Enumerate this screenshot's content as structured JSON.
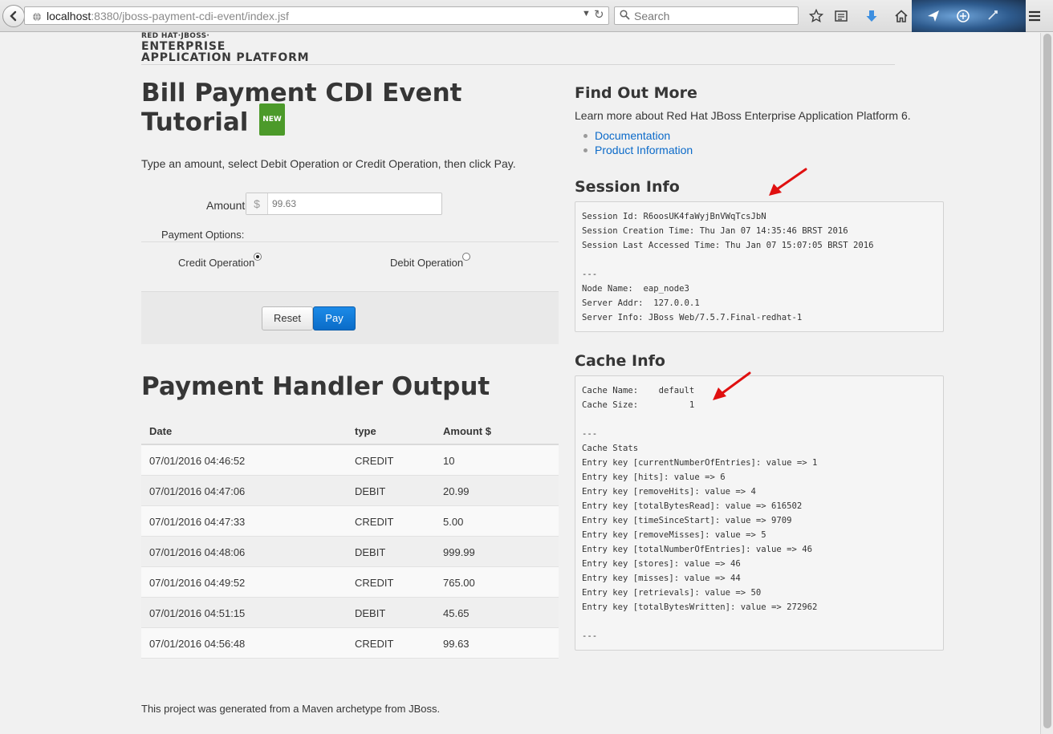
{
  "browser": {
    "url_host": "localhost",
    "url_rest": ":8380/jboss-payment-cdi-event/index.jsf",
    "search_placeholder": "Search"
  },
  "logo": {
    "line1": "RED HAT·JBOSS·",
    "line2": "ENTERPRISE",
    "line3": "APPLICATION PLATFORM"
  },
  "form": {
    "title_line1": "Bill Payment CDI Event",
    "title_line2": "Tutorial",
    "badge": "NEW",
    "instructions": "Type an amount, select Debit Operation or Credit Operation, then click Pay.",
    "amount_label": "Amount:",
    "currency_symbol": "$",
    "amount_value": "99.63",
    "payment_options_label": "Payment Options:",
    "credit_label": "Credit Operation",
    "debit_label": "Debit Operation",
    "selected_option": "credit",
    "reset_label": "Reset",
    "pay_label": "Pay"
  },
  "output": {
    "title": "Payment Handler Output",
    "headers": [
      "Date",
      "type",
      "Amount $"
    ],
    "rows": [
      [
        "07/01/2016 04:46:52",
        "CREDIT",
        "10"
      ],
      [
        "07/01/2016 04:47:06",
        "DEBIT",
        "20.99"
      ],
      [
        "07/01/2016 04:47:33",
        "CREDIT",
        "5.00"
      ],
      [
        "07/01/2016 04:48:06",
        "DEBIT",
        "999.99"
      ],
      [
        "07/01/2016 04:49:52",
        "CREDIT",
        "765.00"
      ],
      [
        "07/01/2016 04:51:15",
        "DEBIT",
        "45.65"
      ],
      [
        "07/01/2016 04:56:48",
        "CREDIT",
        "99.63"
      ]
    ]
  },
  "find_out_more": {
    "title": "Find Out More",
    "text": "Learn more about Red Hat JBoss Enterprise Application Platform 6.",
    "links": [
      "Documentation",
      "Product Information"
    ]
  },
  "session_info": {
    "title": "Session Info",
    "lines": [
      "Session Id: R6oosUK4faWyjBnVWqTcsJbN",
      "Session Creation Time: Thu Jan 07 14:35:46 BRST 2016",
      "Session Last Accessed Time: Thu Jan 07 15:07:05 BRST 2016",
      "",
      "---",
      "Node Name:  eap_node3",
      "Server Addr:  127.0.0.1",
      "Server Info: JBoss Web/7.5.7.Final-redhat-1"
    ]
  },
  "cache_info": {
    "title": "Cache Info",
    "lines": [
      "Cache Name:    default",
      "Cache Size:          1",
      "",
      "---",
      "Cache Stats",
      "Entry key [currentNumberOfEntries]: value => 1",
      "Entry key [hits]: value => 6",
      "Entry key [removeHits]: value => 4",
      "Entry key [totalBytesRead]: value => 616502",
      "Entry key [timeSinceStart]: value => 9709",
      "Entry key [removeMisses]: value => 5",
      "Entry key [totalNumberOfEntries]: value => 46",
      "Entry key [stores]: value => 46",
      "Entry key [misses]: value => 44",
      "Entry key [retrievals]: value => 50",
      "Entry key [totalBytesWritten]: value => 272962",
      "",
      "---"
    ]
  },
  "footer": {
    "text": "This project was generated from a Maven archetype from JBoss."
  },
  "colors": {
    "link": "#0b6ac9",
    "pay_button": "#0a6cc8",
    "new_badge": "#4c9a2a",
    "annotation_arrow": "#e01010"
  },
  "icons": {
    "toolbar": [
      "bookmark-star-icon",
      "reading-list-icon",
      "download-icon",
      "home-icon",
      "share-icon",
      "addon-icon",
      "menu-icon"
    ]
  }
}
